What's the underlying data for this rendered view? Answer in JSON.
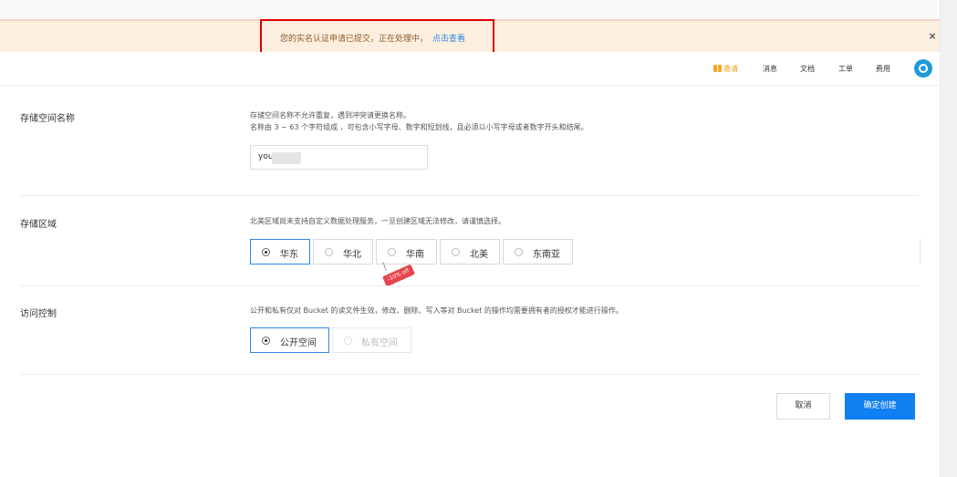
{
  "notice": {
    "message": "您的实名认证申请已提交，正在处理中，",
    "link": "点击查看",
    "close": "×"
  },
  "nav": {
    "invite": "邀请",
    "messages": "消息",
    "docs": "文档",
    "tickets": "工单",
    "billing": "费用"
  },
  "bucket_name": {
    "label": "存储空间名称",
    "desc_line1": "存储空间名称不允许重复，遇到冲突请更换名称。",
    "desc_line2": "名称由 3 ~ 63 个字符组成 ，可包含小写字母、数字和短划线，且必须以小写字母或者数字开头和结尾。",
    "value": "you"
  },
  "region": {
    "label": "存储区域",
    "desc": "北美区域尚未支持自定义数据处理服务，一旦创建区域无法修改，请谨慎选择。",
    "options": [
      "华东",
      "华北",
      "华南",
      "北美",
      "东南亚"
    ],
    "selected": "华东",
    "discount_tag": "-10% off"
  },
  "access": {
    "label": "访问控制",
    "desc": "公开和私有仅对 Bucket 的读文件生效，修改、删除、写入等对 Bucket 的操作均需要拥有者的授权才能进行操作。",
    "options": [
      "公开空间",
      "私有空间"
    ],
    "selected": "公开空间"
  },
  "actions": {
    "cancel": "取消",
    "confirm": "确定创建"
  }
}
